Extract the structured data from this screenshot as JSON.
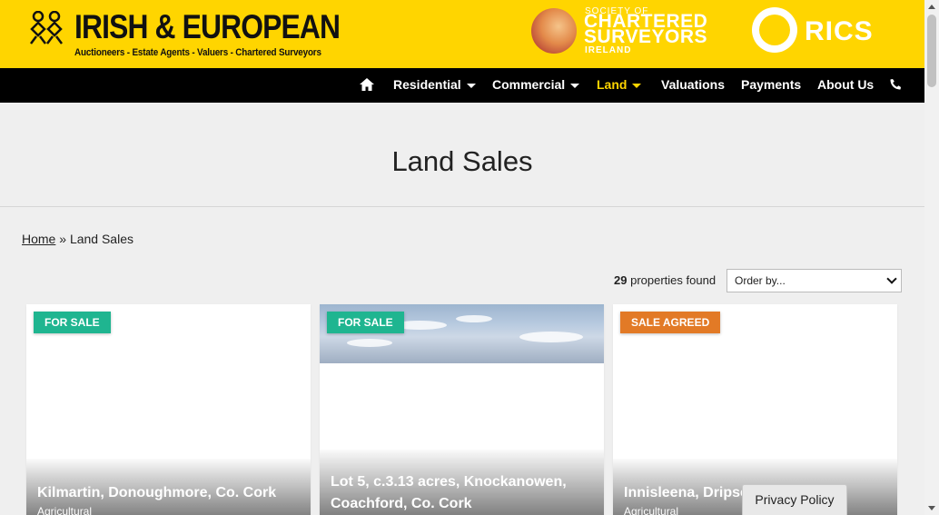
{
  "header": {
    "logo_title": "IRISH & EUROPEAN",
    "logo_tagline": "Auctioneers - Estate Agents - Valuers - Chartered Surveyors",
    "scs_line1": "SOCIETY OF",
    "scs_line2": "CHARTERED",
    "scs_line3": "SURVEYORS",
    "scs_line4": "IRELAND",
    "rics_text": "RICS",
    "brand_color": "#ffd500"
  },
  "nav": {
    "home_icon": "home-icon",
    "items": [
      {
        "label": "Residential"
      },
      {
        "label": "Commercial"
      },
      {
        "label": "Land"
      },
      {
        "label": "Valuations"
      },
      {
        "label": "Payments"
      },
      {
        "label": "About Us"
      }
    ],
    "phone_icon": "phone-icon",
    "active_color": "#ffd500"
  },
  "page": {
    "title": "Land Sales"
  },
  "breadcrumb": {
    "home": "Home",
    "separator": "»",
    "current": "Land Sales"
  },
  "results": {
    "count": "29",
    "label": "properties found",
    "order_placeholder": "Order by..."
  },
  "cards": [
    {
      "badge": "FOR SALE",
      "title": "Kilmartin, Donoughmore, Co. Cork",
      "subtitle": "Agricultural"
    },
    {
      "badge": "FOR SALE",
      "title": "Lot 5, c.3.13 acres, Knockanowen, Coachford, Co. Cork",
      "subtitle": ""
    },
    {
      "badge": "SALE AGREED",
      "title": "Innisleena, Dripsey",
      "subtitle": "Agricultural"
    }
  ],
  "badge_colors": {
    "for_sale": "#1fb590",
    "sale_agreed": "#e27a26"
  },
  "privacy": {
    "label": "Privacy Policy"
  }
}
